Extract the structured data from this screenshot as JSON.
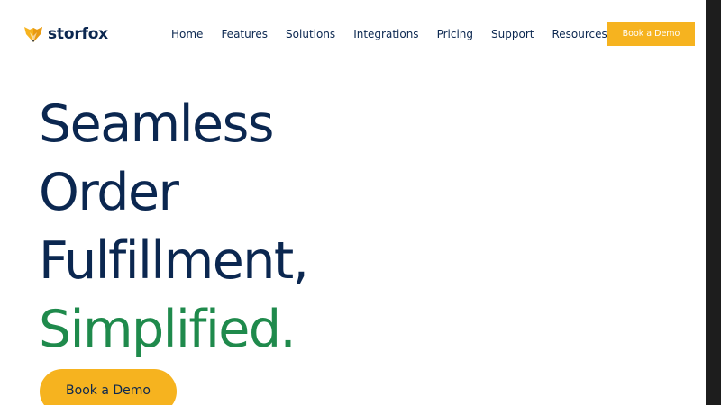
{
  "brand": {
    "name": "storfox",
    "logo_icon": "fox-head-icon",
    "colors": {
      "navy": "#0b2750",
      "accent_yellow": "#f6b31f",
      "accent_green": "#1f8a4c"
    }
  },
  "nav": {
    "items": [
      {
        "label": "Home"
      },
      {
        "label": "Features"
      },
      {
        "label": "Solutions"
      },
      {
        "label": "Integrations"
      },
      {
        "label": "Pricing"
      },
      {
        "label": "Support"
      },
      {
        "label": "Resources"
      }
    ]
  },
  "header_cta": {
    "label": "Book a Demo"
  },
  "hero": {
    "lines": [
      "Seamless",
      "Order",
      "Fulfillment,"
    ],
    "accent_line": "Simplified.",
    "cta_label": "Book a Demo"
  }
}
